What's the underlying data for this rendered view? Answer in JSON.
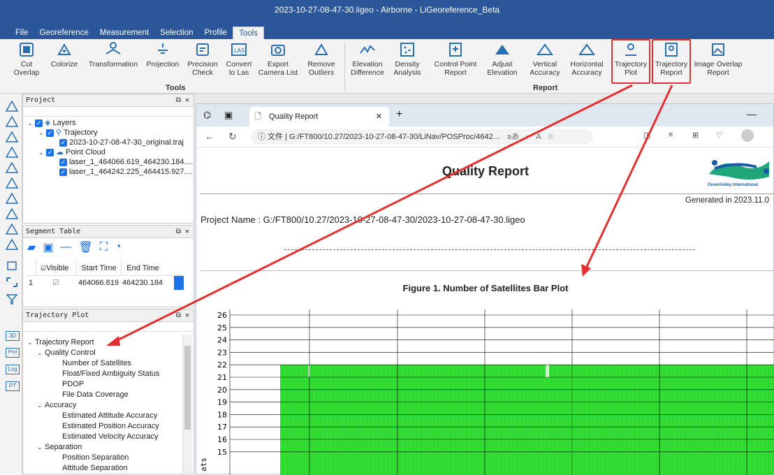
{
  "window": {
    "title": "2023-10-27-08-47-30.ligeo - Airborne - LiGeoreference_Beta"
  },
  "menu": [
    "File",
    "Georeference",
    "Measurement",
    "Selection",
    "Profile",
    "Tools"
  ],
  "ribbon": {
    "tools": [
      {
        "label": "Cut\nOverlap",
        "icon": "cut-overlap-icon"
      },
      {
        "label": "Colorize",
        "icon": "colorize-icon"
      },
      {
        "label": "Transformation",
        "icon": "transformation-icon"
      },
      {
        "label": "Projection",
        "icon": "projection-icon"
      },
      {
        "label": "Precision\nCheck",
        "icon": "precision-check-icon"
      },
      {
        "label": "Convert\nto Las",
        "icon": "las-icon"
      },
      {
        "label": "Export\nCamera List",
        "icon": "camera-icon"
      },
      {
        "label": "Remove\nOutliers",
        "icon": "remove-outliers-icon"
      }
    ],
    "tools_group": "Tools",
    "report": [
      {
        "label": "Elevation\nDifference",
        "icon": "elevation-difference-icon"
      },
      {
        "label": "Density\nAnalysis",
        "icon": "density-icon"
      },
      {
        "label": "Control Point\nReport",
        "icon": "control-point-icon"
      },
      {
        "label": "Adjust\nElevation",
        "icon": "adjust-elevation-icon"
      },
      {
        "label": "Vertical\nAccuracy",
        "icon": "vertical-accuracy-icon"
      },
      {
        "label": "Horizontal\nAccuracy",
        "icon": "horizontal-accuracy-icon"
      },
      {
        "label": "Trajectory\nPlot",
        "icon": "trajectory-plot-icon"
      },
      {
        "label": "Trajectory\nReport",
        "icon": "trajectory-report-icon"
      },
      {
        "label": "Image Overlap\nReport",
        "icon": "image-overlap-icon"
      }
    ],
    "report_group": "Report"
  },
  "left_icons": [
    "H",
    "T",
    "C",
    "G",
    "R",
    "T",
    "B",
    "M",
    "S",
    "T"
  ],
  "left_icons2": [
    "3D",
    "Prof",
    "Log",
    "PT"
  ],
  "project": {
    "title": "Project",
    "layers": "Layers",
    "trajectory": "Trajectory",
    "traj_file": "2023-10-27-08-47-30_original.traj",
    "point_cloud": "Point Cloud",
    "laser1": "laser_1_464066.619_464230.184....",
    "laser2": "laser_1_464242.225_464415.927...."
  },
  "segment": {
    "title": "Segment Table",
    "headers": [
      "Visible",
      "Start Time",
      "End Time"
    ],
    "row": {
      "index": "1",
      "start": "464066.619",
      "end": "464230.184"
    }
  },
  "trajplot": {
    "title": "Trajectory Plot",
    "tree": [
      {
        "label": "Trajectory Report",
        "level": 0,
        "chev": "v"
      },
      {
        "label": "Quality Control",
        "level": 1,
        "chev": "v"
      },
      {
        "label": "Number of Satellites",
        "level": 2
      },
      {
        "label": "Float/Fixed Ambiguity Status",
        "level": 2
      },
      {
        "label": "PDOP",
        "level": 2
      },
      {
        "label": "File Data Coverage",
        "level": 2
      },
      {
        "label": "Accuracy",
        "level": 1,
        "chev": "v"
      },
      {
        "label": "Estimated Attitude Accuracy",
        "level": 2
      },
      {
        "label": "Estimated Position Accuracy",
        "level": 2
      },
      {
        "label": "Estimated Velocity Accuracy",
        "level": 2
      },
      {
        "label": "Separation",
        "level": 1,
        "chev": "v"
      },
      {
        "label": "Position Separation",
        "level": 2
      },
      {
        "label": "Attitude Separation",
        "level": 2
      }
    ]
  },
  "browser": {
    "tab": "Quality Report",
    "address_prefix": "ⓘ 文件 |",
    "address": "G:/FT800/10.27/2023-10-27-08-47-30/LiNav/POSProc/4642...",
    "doc": {
      "title": "Quality Report",
      "logo_text": "GreenValley International",
      "generated": "Generated in 2023.11.0",
      "project_name": "Project Name : G:/FT800/10.27/2023-10-27-08-47-30/2023-10-27-08-47-30.ligeo",
      "figure_title": "Figure 1. Number of Satellites Bar Plot",
      "ylabel_partial": "ats"
    }
  },
  "chart_data": {
    "type": "bar",
    "ylim": [
      14,
      26
    ],
    "yticks": [
      "26",
      "25",
      "24",
      "23",
      "22",
      "21",
      "20",
      "19",
      "18",
      "17",
      "16",
      "15"
    ],
    "value": 22,
    "color": "#33dd33",
    "grid": true
  }
}
